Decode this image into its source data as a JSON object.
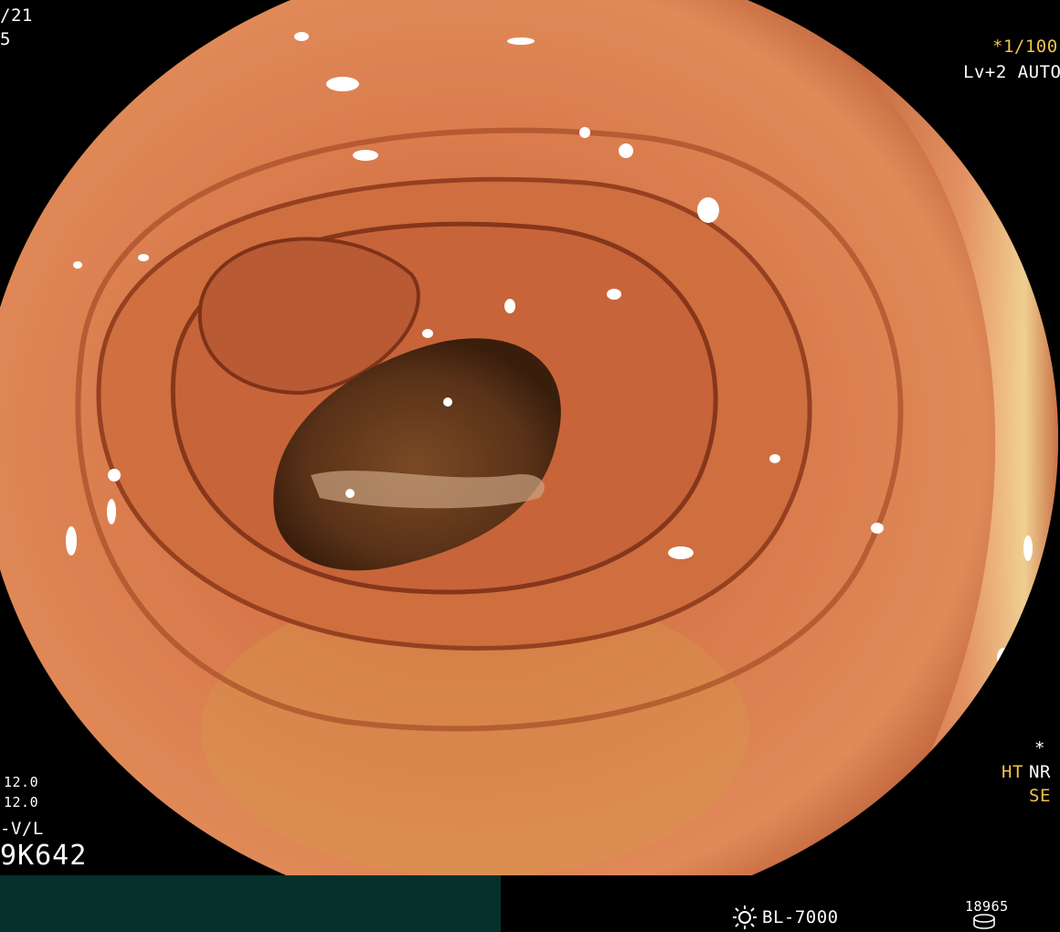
{
  "overlay": {
    "date_fragment": "/21",
    "date_line2_fragment": "5",
    "shutter": "*1/100",
    "level_mode": "Lv+2 AUTO",
    "star_marker": "*",
    "enhance_label": "HT",
    "noise_label": "NR",
    "se_label": "SE",
    "value_1": "12.0",
    "value_2": "12.0",
    "view_mode": "-V/L",
    "scope_id": "9K642",
    "light_source": "BL-7000",
    "counter": "18965"
  },
  "icons": {
    "lamp": "light-source-icon",
    "disk": "storage-disk-icon"
  },
  "colors": {
    "overlay_yellow": "#f2c24a",
    "bottom_bar": "#06302c",
    "mucosa": "#d8744a",
    "lumen": "#5a3218"
  }
}
